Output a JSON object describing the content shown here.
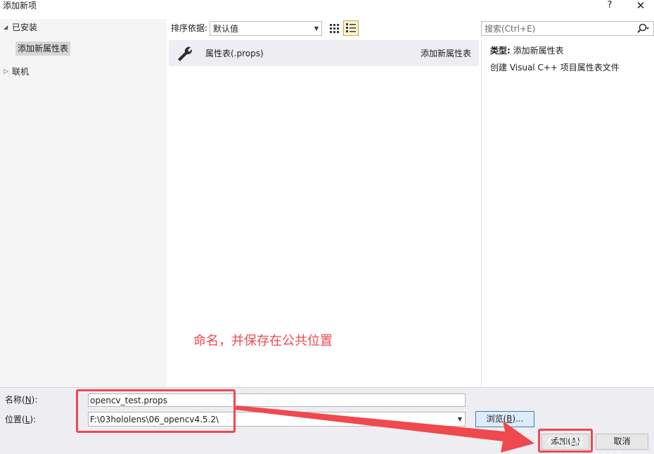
{
  "window": {
    "title": "添加新项",
    "help_label": "?",
    "close_label": "✕"
  },
  "tree": {
    "installed_label": "已安装",
    "selected_item": "添加新属性表",
    "online_label": "联机"
  },
  "toolbar": {
    "sort_label": "排序依据:",
    "sort_value": "默认值",
    "search_placeholder": "搜索(Ctrl+E)"
  },
  "templates": [
    {
      "name": "属性表(.props)",
      "category": "添加新属性表",
      "icon": "wrench-icon"
    }
  ],
  "details": {
    "type_key": "类型:",
    "type_value": "添加新属性表",
    "description": "创建 Visual C++ 项目属性表文件"
  },
  "annotation_text": "命名，并保存在公共位置",
  "form": {
    "name_label_prefix": "名称(",
    "name_label_key": "N",
    "name_label_suffix": "):",
    "name_value": "opencv_test.props",
    "location_label_prefix": "位置(",
    "location_label_key": "L",
    "location_label_suffix": "):",
    "location_value": "F:\\03hololens\\06_opencv4.5.2\\",
    "browse_prefix": "浏览(",
    "browse_key": "B",
    "browse_suffix": ")...",
    "add_prefix": "添加(",
    "add_key": "A",
    "add_suffix": ")",
    "cancel_label": "取消"
  },
  "watermark": "CSDN @WMX2012",
  "colors": {
    "accent_red": "#f0484f",
    "browse_border": "#3c7fb1"
  }
}
